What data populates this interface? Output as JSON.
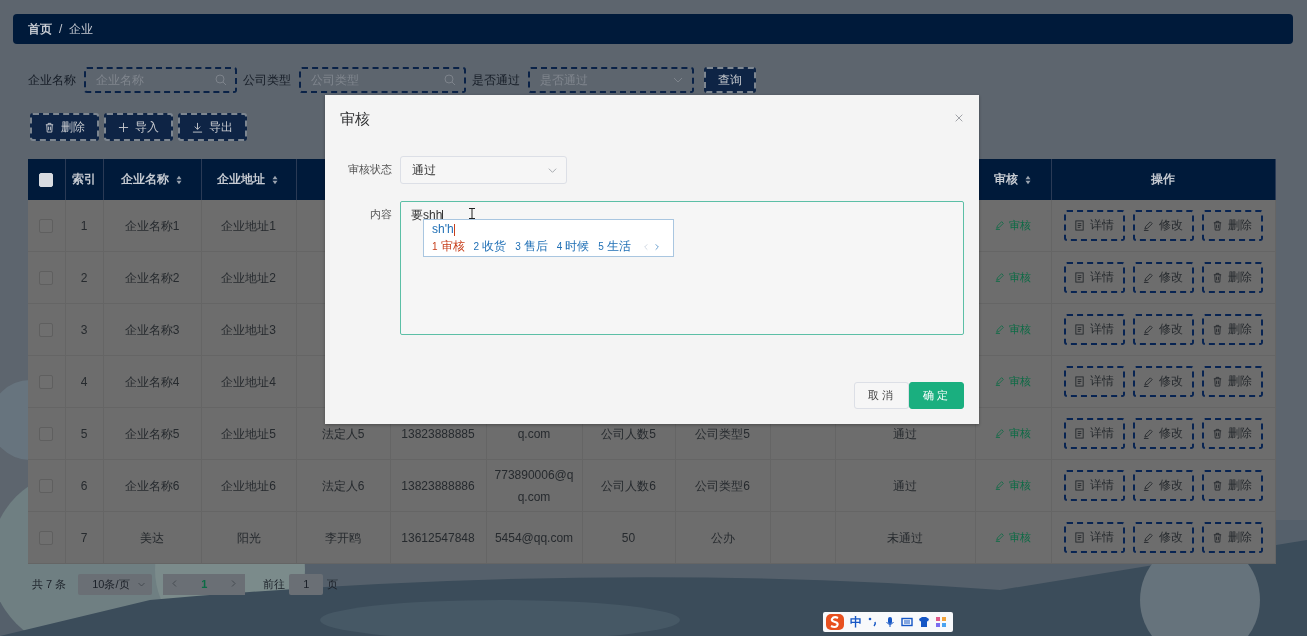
{
  "breadcrumb": {
    "items": [
      {
        "label": "首页",
        "current": false
      },
      {
        "label": "企业",
        "current": true
      }
    ],
    "separator": "/"
  },
  "filters": [
    {
      "kind": "search",
      "label": "企业名称",
      "placeholder": "企业名称"
    },
    {
      "kind": "search",
      "label": "公司类型",
      "placeholder": "公司类型"
    },
    {
      "kind": "select",
      "label": "是否通过",
      "placeholder": "是否通过"
    }
  ],
  "query_button": "查询",
  "toolbar": [
    {
      "kind": "delete",
      "label": "删除"
    },
    {
      "kind": "import",
      "label": "导入"
    },
    {
      "kind": "export",
      "label": "导出"
    }
  ],
  "table": {
    "select_all": {
      "checked": false
    },
    "columns": [
      {
        "kind": "text",
        "label": "索引",
        "sortable": false
      },
      {
        "kind": "text",
        "label": "企业名称",
        "sortable": true
      },
      {
        "kind": "text",
        "label": "企业地址",
        "sortable": true
      },
      {
        "kind": "blank"
      },
      {
        "kind": "blank"
      },
      {
        "kind": "blank"
      },
      {
        "kind": "blank"
      },
      {
        "kind": "blank"
      },
      {
        "kind": "blank"
      },
      {
        "kind": "blank"
      },
      {
        "kind": "text",
        "label": "审核",
        "sortable": true
      },
      {
        "kind": "text",
        "label": "操作",
        "sortable": false
      }
    ],
    "rows": [
      {
        "checked": false,
        "cells": [
          "1",
          "企业名称1",
          "企业地址1"
        ],
        "review": "审核",
        "actions": [
          {
            "kind": "detail",
            "label": "详情"
          },
          {
            "kind": "edit",
            "label": "修改"
          },
          {
            "kind": "delete",
            "label": "删除"
          }
        ]
      },
      {
        "checked": false,
        "cells": [
          "2",
          "企业名称2",
          "企业地址2"
        ],
        "review": "审核",
        "actions": [
          {
            "kind": "detail",
            "label": "详情"
          },
          {
            "kind": "edit",
            "label": "修改"
          },
          {
            "kind": "delete",
            "label": "删除"
          }
        ]
      },
      {
        "checked": false,
        "cells": [
          "3",
          "企业名称3",
          "企业地址3"
        ],
        "review": "审核",
        "actions": [
          {
            "kind": "detail",
            "label": "详情"
          },
          {
            "kind": "edit",
            "label": "修改"
          },
          {
            "kind": "delete",
            "label": "删除"
          }
        ]
      },
      {
        "checked": false,
        "cells": [
          "4",
          "企业名称4",
          "企业地址4"
        ],
        "review": "审核",
        "actions": [
          {
            "kind": "detail",
            "label": "详情"
          },
          {
            "kind": "edit",
            "label": "修改"
          },
          {
            "kind": "delete",
            "label": "删除"
          }
        ]
      },
      {
        "checked": false,
        "cells": [
          "5",
          "企业名称5",
          "企业地址5",
          "法定人5",
          "13823888885",
          "q.com",
          "公司人数5",
          "公司类型5",
          "",
          "通过"
        ],
        "review": "审核",
        "actions": [
          {
            "kind": "detail",
            "label": "详情"
          },
          {
            "kind": "edit",
            "label": "修改"
          },
          {
            "kind": "delete",
            "label": "删除"
          }
        ]
      },
      {
        "checked": false,
        "cells": [
          "6",
          "企业名称6",
          "企业地址6",
          "法定人6",
          "13823888886",
          "773890006@qq.com",
          "公司人数6",
          "公司类型6",
          "",
          "通过"
        ],
        "review": "审核",
        "actions": [
          {
            "kind": "detail",
            "label": "详情"
          },
          {
            "kind": "edit",
            "label": "修改"
          },
          {
            "kind": "delete",
            "label": "删除"
          }
        ]
      },
      {
        "checked": false,
        "cells": [
          "7",
          "美达",
          "阳光",
          "李开鸥",
          "13612547848",
          "5454@qq.com",
          "50",
          "公办",
          "",
          "未通过"
        ],
        "review": "审核",
        "actions": [
          {
            "kind": "detail",
            "label": "详情"
          },
          {
            "kind": "edit",
            "label": "修改"
          },
          {
            "kind": "delete",
            "label": "删除"
          }
        ]
      }
    ]
  },
  "pagination": {
    "total": "共 7 条",
    "page_size": "10条/页",
    "pages": [
      {
        "label": "1",
        "selected": true
      }
    ],
    "goto_label": "前往",
    "goto_value": "1",
    "goto_suffix": "页"
  },
  "dialog": {
    "title": "审核",
    "fields": [
      {
        "kind": "select",
        "label": "审核状态",
        "value": "通过"
      },
      {
        "kind": "textarea",
        "label": "内容",
        "value": "要shh"
      }
    ],
    "buttons": [
      {
        "kind": "cancel",
        "label": "取消"
      },
      {
        "kind": "confirm",
        "label": "确定"
      }
    ]
  },
  "ime": {
    "composition": "sh'h",
    "candidates": [
      {
        "number": "1",
        "text": "审核",
        "selected": true
      },
      {
        "number": "2",
        "text": "收货",
        "selected": false
      },
      {
        "number": "3",
        "text": "售后",
        "selected": false
      },
      {
        "number": "4",
        "text": "时候",
        "selected": false
      },
      {
        "number": "5",
        "text": "生活",
        "selected": false
      }
    ]
  },
  "ime_toolbar": {
    "mode": "中"
  }
}
